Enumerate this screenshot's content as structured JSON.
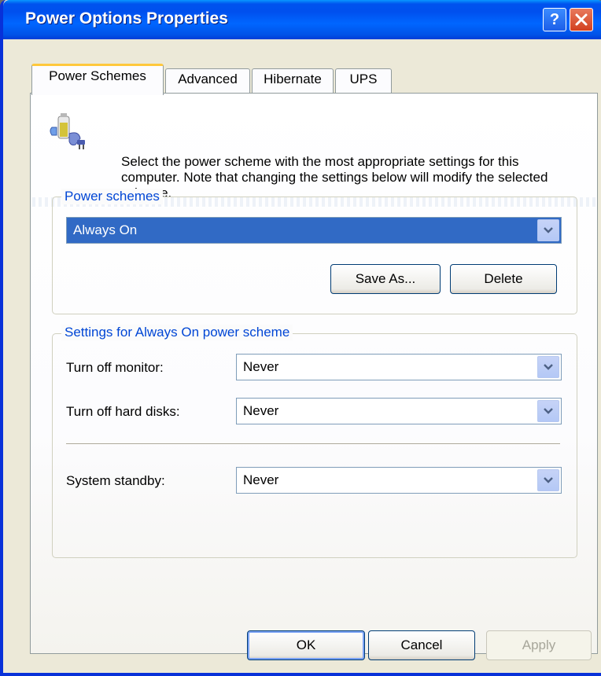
{
  "window": {
    "title": "Power Options Properties"
  },
  "tabs": [
    {
      "label": "Power Schemes",
      "active": true
    },
    {
      "label": "Advanced"
    },
    {
      "label": "Hibernate"
    },
    {
      "label": "UPS"
    }
  ],
  "description": "Select the power scheme with the most appropriate settings for this computer. Note that changing the settings below will modify the selected scheme.",
  "power_schemes": {
    "group_label": "Power schemes",
    "selected": "Always On",
    "save_as_label": "Save As...",
    "delete_label": "Delete"
  },
  "settings": {
    "group_label": "Settings for Always On power scheme",
    "monitor_label": "Turn off monitor:",
    "monitor_value": "Never",
    "disks_label": "Turn off hard disks:",
    "disks_value": "Never",
    "standby_label": "System standby:",
    "standby_value": "Never"
  },
  "footer": {
    "ok_label": "OK",
    "cancel_label": "Cancel",
    "apply_label": "Apply"
  },
  "colors": {
    "titlebar": "#0053ee",
    "group_label": "#0046d5",
    "selection": "#316ac5"
  }
}
